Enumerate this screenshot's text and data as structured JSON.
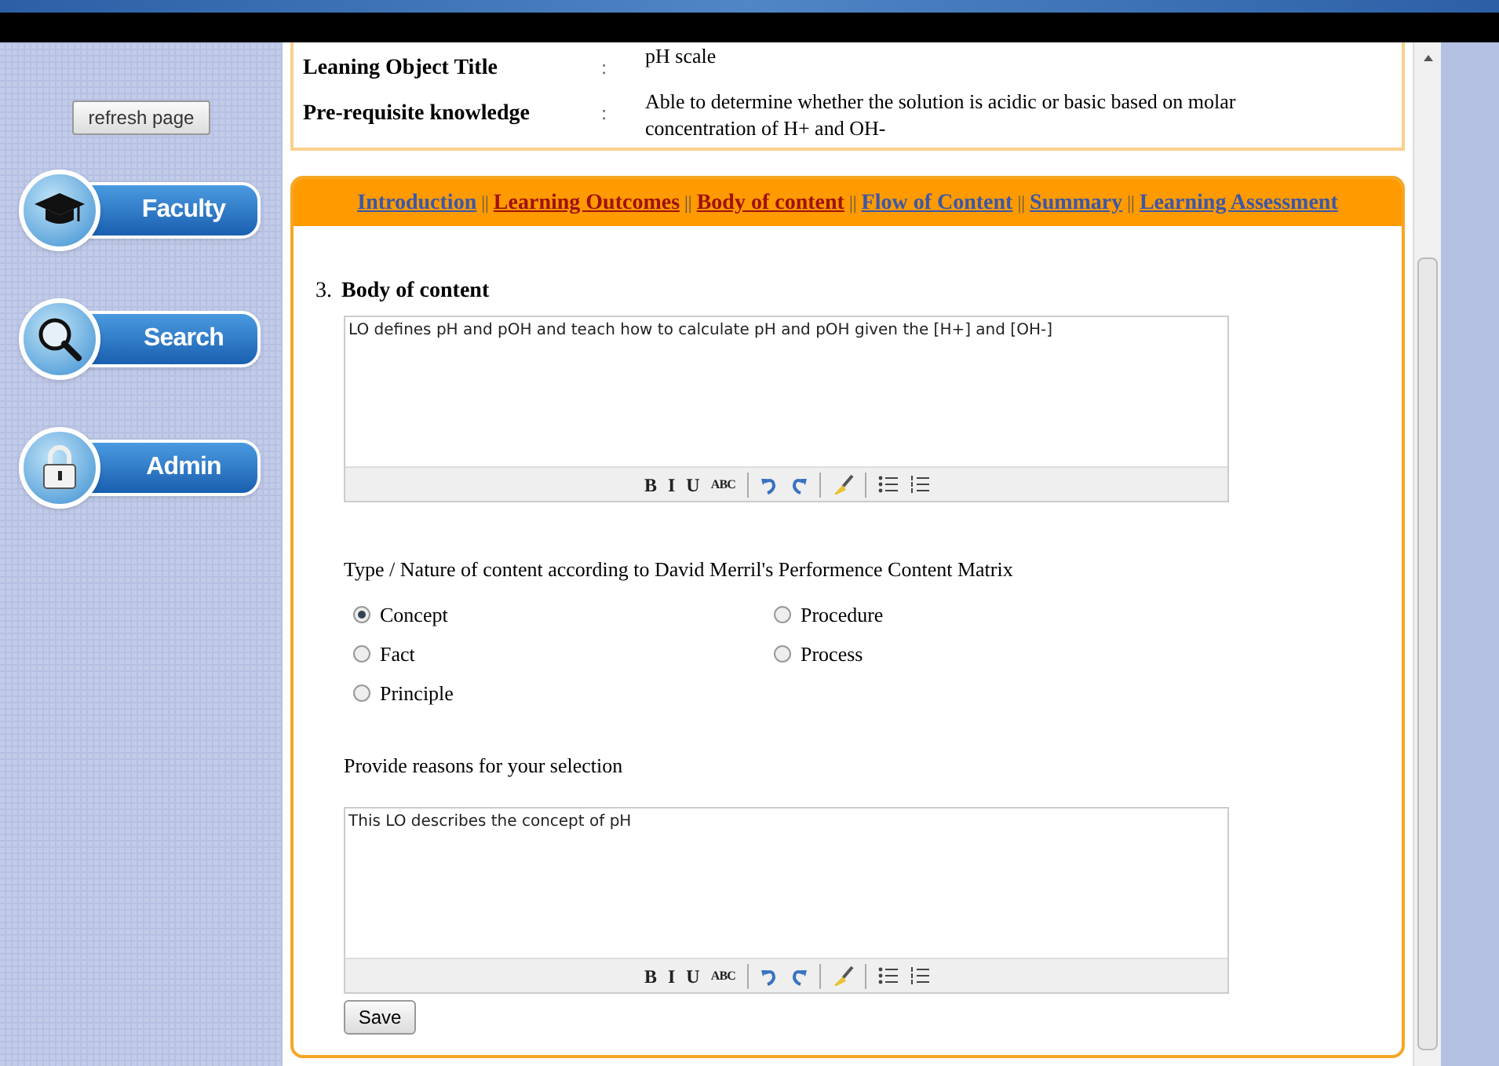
{
  "sidebar": {
    "refresh_button": "refresh page",
    "nav": [
      {
        "label": "Faculty",
        "kind": "cap"
      },
      {
        "label": "Search",
        "kind": "search"
      },
      {
        "label": "Admin",
        "kind": "lock"
      }
    ]
  },
  "info": [
    {
      "label": "Leaning Object Title",
      "separator": ":",
      "value": "pH scale"
    },
    {
      "label": "Pre-requisite knowledge",
      "separator": ":",
      "value": "Able to determine whether the solution is acidic or basic based on molar concentration of H+ and OH-"
    }
  ],
  "tabs": [
    {
      "label": "Introduction",
      "visited": false
    },
    {
      "label": "Learning Outcomes",
      "visited": true
    },
    {
      "label": "Body of content",
      "visited": true
    },
    {
      "label": "Flow of Content",
      "visited": false
    },
    {
      "label": "Summary",
      "visited": false
    },
    {
      "label": "Learning Assessment",
      "visited": false
    }
  ],
  "tab_separator": "||",
  "section": {
    "number": "3.",
    "title": "Body of content",
    "editor": {
      "value": "LO defines pH and pOH and teach how to calculate pH and pOH given the [H+] and [OH-]",
      "toolbar": [
        {
          "kind": "text",
          "label": "B"
        },
        {
          "kind": "text",
          "label": "I"
        },
        {
          "kind": "text",
          "label": "U"
        },
        {
          "kind": "text",
          "label": "ABC"
        },
        {
          "kind": "separator"
        },
        {
          "kind": "undo"
        },
        {
          "kind": "redo"
        },
        {
          "kind": "separator"
        },
        {
          "kind": "eraser"
        },
        {
          "kind": "separator"
        },
        {
          "kind": "bullets"
        },
        {
          "kind": "numbers"
        }
      ]
    },
    "question": "Type / Nature of content according to David Merril's Performence Content Matrix",
    "options": [
      {
        "label": "Concept",
        "selected": true
      },
      {
        "label": "Fact",
        "selected": false
      },
      {
        "label": "Principle",
        "selected": false
      },
      {
        "label": "Procedure",
        "selected": false
      },
      {
        "label": "Process",
        "selected": false
      }
    ],
    "reasons_label": "Provide reasons for your selection",
    "reasons_editor": {
      "value": "This LO describes the concept of pH",
      "toolbar": [
        {
          "kind": "text",
          "label": "B"
        },
        {
          "kind": "text",
          "label": "I"
        },
        {
          "kind": "text",
          "label": "U"
        },
        {
          "kind": "text",
          "label": "ABC"
        },
        {
          "kind": "separator"
        },
        {
          "kind": "undo"
        },
        {
          "kind": "redo"
        },
        {
          "kind": "separator"
        },
        {
          "kind": "eraser"
        },
        {
          "kind": "separator"
        },
        {
          "kind": "bullets"
        },
        {
          "kind": "numbers"
        }
      ]
    },
    "save_button": "Save"
  }
}
